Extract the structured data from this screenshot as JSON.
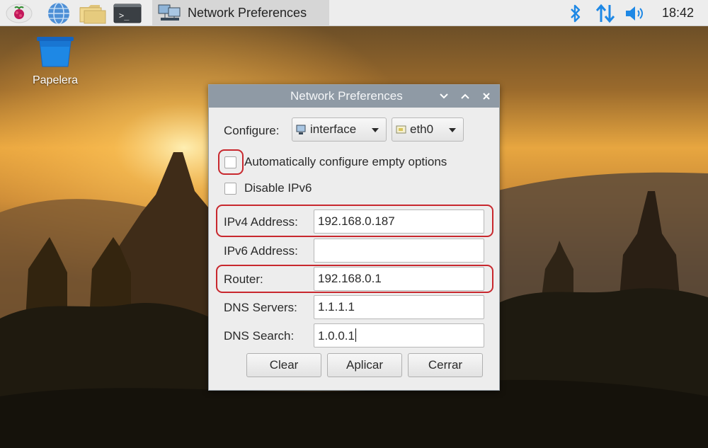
{
  "taskbar": {
    "menu_icon": "raspberry-icon",
    "browser_icon": "globe-icon",
    "files_icon": "folder-icon",
    "terminal_icon": "terminal-icon",
    "terminal_glyph": ">_",
    "task_label": "Network Preferences",
    "tray": {
      "bluetooth_icon": "bluetooth-icon",
      "network_icon": "network-arrows-icon",
      "volume_icon": "volume-icon"
    },
    "clock": "18:42"
  },
  "desktop": {
    "trash_label": "Papelera"
  },
  "dialog": {
    "title": "Network Preferences",
    "controls": {
      "minimize": "⌄",
      "maximize": "⌃",
      "close": "✕"
    },
    "configure_label": "Configure:",
    "configure_value": "interface",
    "interface_value": "eth0",
    "auto_configure_label": "Automatically configure empty options",
    "auto_configure_checked": false,
    "disable_ipv6_label": "Disable IPv6",
    "disable_ipv6_checked": false,
    "fields": {
      "ipv4_label": "IPv4 Address:",
      "ipv4_value": "192.168.0.187",
      "ipv6_label": "IPv6 Address:",
      "ipv6_value": "",
      "router_label": "Router:",
      "router_value": "192.168.0.1",
      "dns_label": "DNS Servers:",
      "dns_value": "1.1.1.1",
      "search_label": "DNS Search:",
      "search_value": "1.0.0.1"
    },
    "buttons": {
      "clear": "Clear",
      "apply": "Aplicar",
      "close": "Cerrar"
    }
  },
  "colors": {
    "annotation": "#c8282e",
    "titlebar": "#8f9aa5",
    "dialog_bg": "#ededed",
    "taskbar_bg": "#ededed",
    "tray_blue": "#1e88e5"
  }
}
